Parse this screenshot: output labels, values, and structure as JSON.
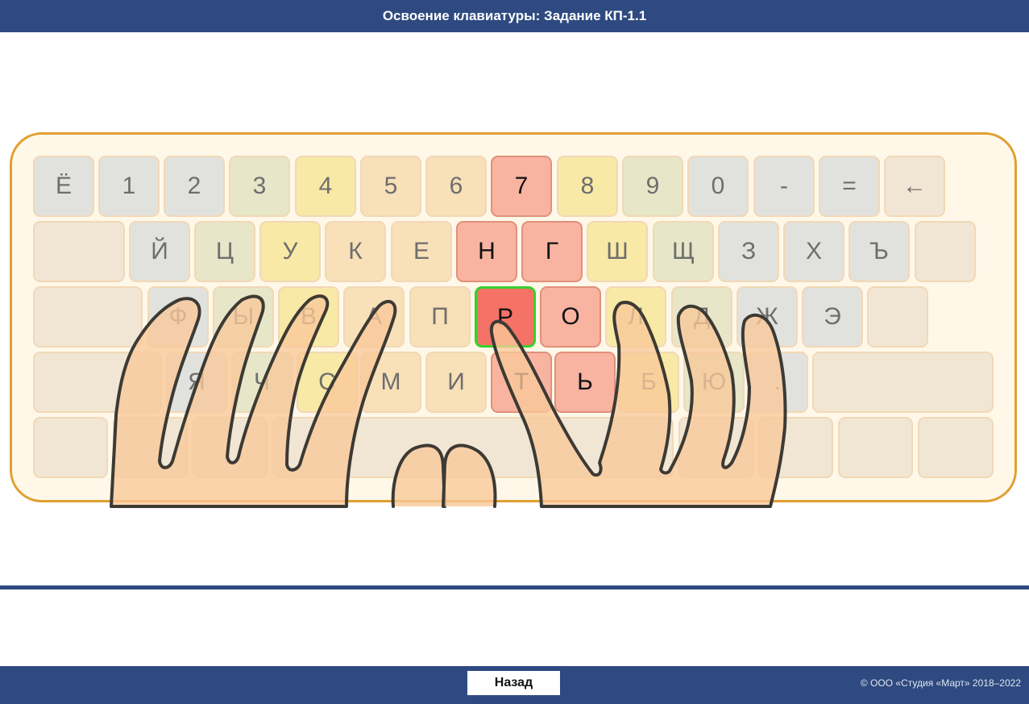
{
  "header": {
    "title": "Освоение клавиатуры: Задание КП-1.1"
  },
  "keyboard": {
    "row1": [
      "Ё",
      "1",
      "2",
      "3",
      "4",
      "5",
      "6",
      "7",
      "8",
      "9",
      "0",
      "-",
      "=",
      "←"
    ],
    "row2": [
      "Й",
      "Ц",
      "У",
      "К",
      "Е",
      "Н",
      "Г",
      "Ш",
      "Щ",
      "З",
      "Х",
      "Ъ"
    ],
    "row3": [
      "Ф",
      "Ы",
      "В",
      "А",
      "П",
      "Р",
      "О",
      "Л",
      "Д",
      "Ж",
      "Э"
    ],
    "row4": [
      "Я",
      "Ч",
      "С",
      "М",
      "И",
      "Т",
      "Ь",
      "Б",
      "Ю",
      "."
    ],
    "highlighted_keys": [
      "7",
      "Н",
      "Г",
      "Р",
      "О",
      "Т",
      "Ь"
    ],
    "current_key": "Р",
    "colors": {
      "highlight": "#f8b4a0",
      "current": "#f47366",
      "current_border": "#38d02c",
      "frame": "#e0a030"
    }
  },
  "footer": {
    "back_label": "Назад",
    "copyright": "© ООО «Студия «Март» 2018–2022"
  }
}
